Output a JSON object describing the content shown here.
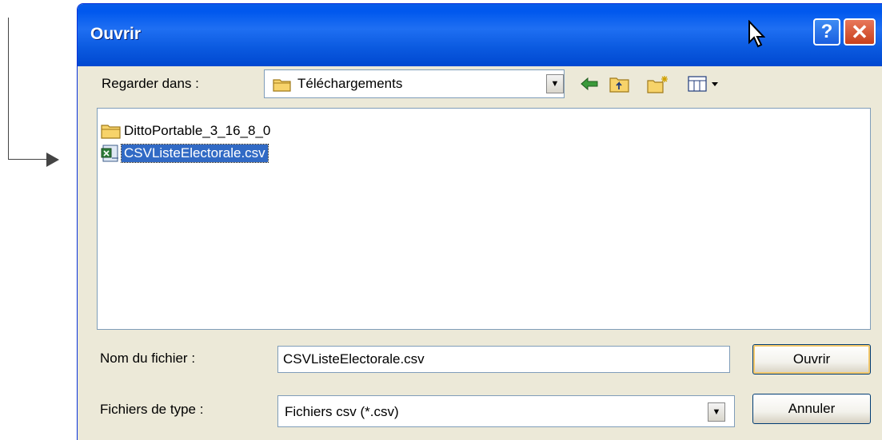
{
  "dialog": {
    "title": "Ouvrir",
    "help_label": "?",
    "close_label": "✕"
  },
  "lookin": {
    "label": "Regarder dans :",
    "value": "Téléchargements"
  },
  "files": [
    {
      "name": "DittoPortable_3_16_8_0",
      "icon": "folder-icon"
    },
    {
      "name": "CSVListeElectorale.csv",
      "icon": "csv-file-icon"
    }
  ],
  "filename": {
    "label": "Nom du fichier :",
    "value": "CSVListeElectorale.csv"
  },
  "filetype": {
    "label": "Fichiers de type :",
    "value": "Fichiers csv (*.csv)"
  },
  "buttons": {
    "open": "Ouvrir",
    "cancel": "Annuler"
  },
  "colors": {
    "titlebar": "#0a5de8",
    "selection": "#316ac5",
    "dialog_bg": "#ece9d8"
  }
}
